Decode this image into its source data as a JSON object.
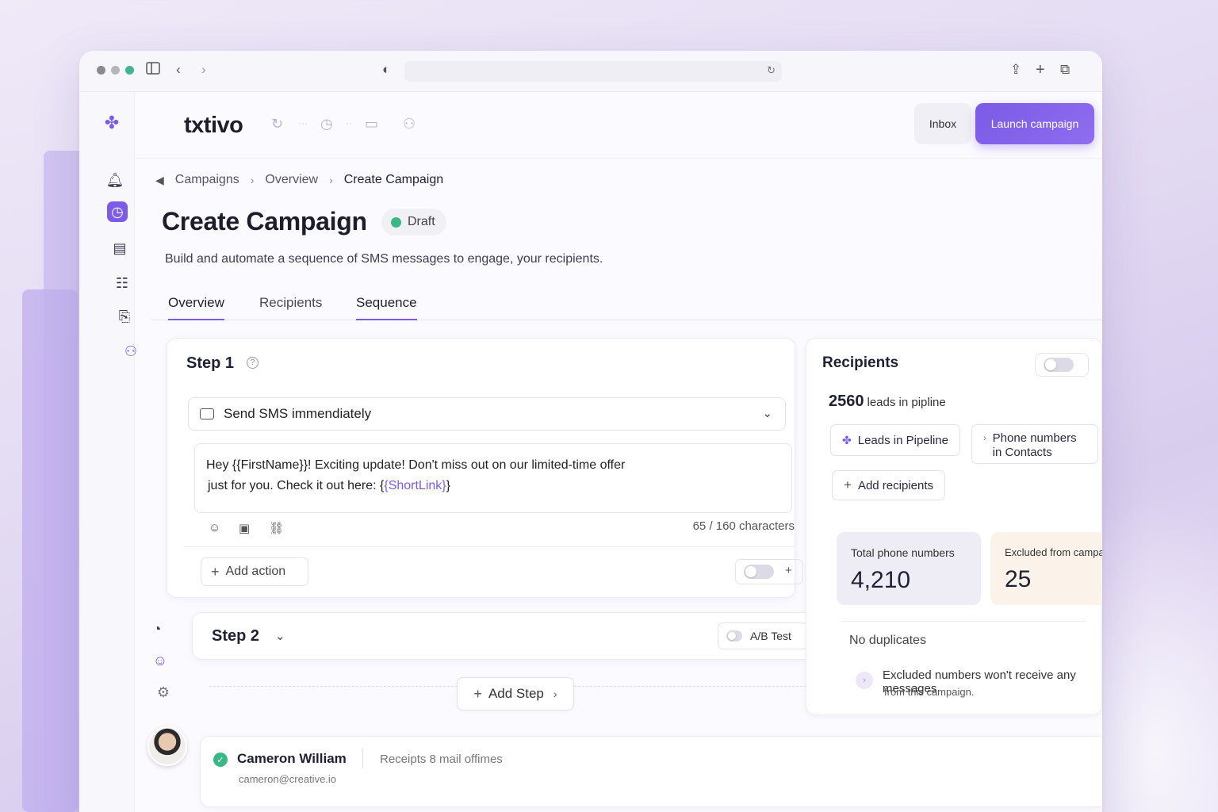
{
  "app": {
    "brand": "txtivo"
  },
  "browser": {
    "url": ""
  },
  "header": {
    "inbox_label": "Inbox",
    "launch_label": "Launch campaign"
  },
  "breadcrumb": [
    "Campaigns",
    "Overview",
    "Create Campaign"
  ],
  "page": {
    "title": "Create Campaign",
    "status": "Draft",
    "subtitle": "Build and automate a sequence of SMS messages to engage, your recipients."
  },
  "tabs": [
    "Overview",
    "Recipients",
    "Sequence"
  ],
  "step1": {
    "title": "Step 1",
    "action_select": "Send SMS immendiately",
    "message_line1": "Hey {{FirstName}}! Exciting update! Don't miss out on our limited-time offer",
    "message_line2_prefix": "just for you. Check it out here: {",
    "message_var": "{ShortLink}",
    "message_line2_suffix": "}",
    "char_count": "65",
    "char_limit": "/ 160 characters",
    "add_action_label": "Add action",
    "toggle_plus": "+"
  },
  "step2": {
    "title": "Step 2",
    "ab_label": "A/B Test"
  },
  "add_step_label": "Add Step",
  "recipients": {
    "title": "Recipients",
    "leads_count": "2560",
    "leads_text": "leads in pipline",
    "chip_leads": "Leads in Pipeline",
    "chip_phone_line1": "Phone numbers",
    "chip_phone_line2": "in Contacts",
    "add_recipients_label": "Add recipients",
    "total_label": "Total phone numbers",
    "total_value": "4,210",
    "excluded_label": "Excluded from campaign",
    "excluded_value": "25",
    "no_duplicates": "No duplicates",
    "note_line1": "Excluded numbers won't receive any messages",
    "note_line2": "from this campaign."
  },
  "footer": {
    "name": "Cameron William",
    "receipts": "Receipts 8 mail offimes",
    "email": "cameron@creative.io"
  },
  "colors": {
    "accent": "#7b5be6",
    "status_green": "#39b886",
    "total_bg": "#eeedf6",
    "excluded_bg": "#fbf3ea"
  }
}
